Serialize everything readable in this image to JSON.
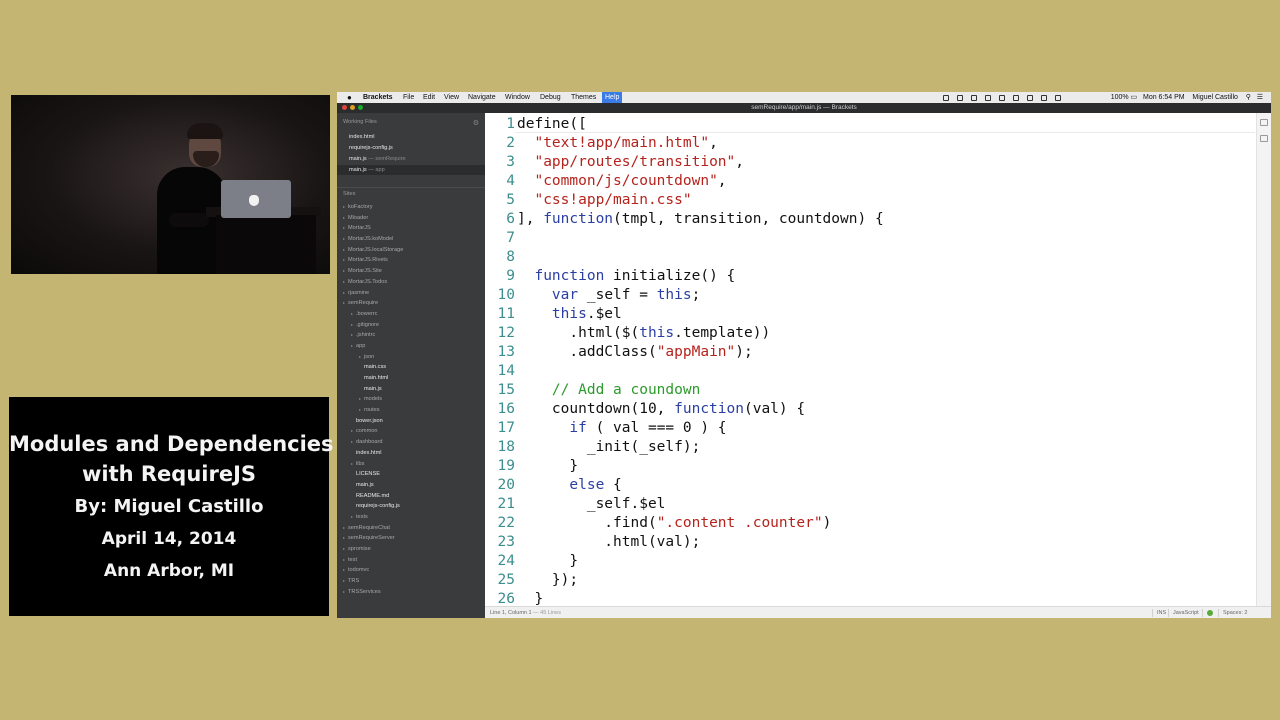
{
  "card": {
    "title_line1": "Modules and Dependencies",
    "title_line2": "with RequireJS",
    "byline": "By: Miguel Castillo",
    "date": "April 14, 2014",
    "location": "Ann Arbor, MI"
  },
  "menubar": {
    "app": "Brackets",
    "items": [
      "File",
      "Edit",
      "View",
      "Navigate",
      "Window",
      "Debug",
      "Themes",
      "Help"
    ],
    "selected": "Help",
    "battery": "100%",
    "clock": "Mon 6:54 PM",
    "user": "Miguel Castillo"
  },
  "window": {
    "title": "semRequire/app/main.js — Brackets"
  },
  "sidebar": {
    "working_files_label": "Working Files",
    "working_files": [
      {
        "name": "index.html",
        "detail": ""
      },
      {
        "name": "requirejs-config.js",
        "detail": ""
      },
      {
        "name": "main.js",
        "detail": "— semRequire"
      },
      {
        "name": "main.js",
        "detail": "— app"
      }
    ],
    "sites_label": "Sites",
    "tree": [
      {
        "label": "koFactory",
        "kind": "folder",
        "depth": 0
      },
      {
        "label": "Mloader",
        "kind": "folder",
        "depth": 0
      },
      {
        "label": "MortarJS",
        "kind": "folder",
        "depth": 0
      },
      {
        "label": "MortarJS.koModel",
        "kind": "folder",
        "depth": 0
      },
      {
        "label": "MortarJS.localStorage",
        "kind": "folder",
        "depth": 0
      },
      {
        "label": "MortarJS.Rivets",
        "kind": "folder",
        "depth": 0
      },
      {
        "label": "MortarJS.Site",
        "kind": "folder",
        "depth": 0
      },
      {
        "label": "MortarJS.Todos",
        "kind": "folder",
        "depth": 0
      },
      {
        "label": "rjasmine",
        "kind": "folder",
        "depth": 0
      },
      {
        "label": "semRequire",
        "kind": "folder",
        "depth": 0
      },
      {
        "label": ".bowerrc",
        "kind": "folder",
        "depth": 1
      },
      {
        "label": ".gitignore",
        "kind": "folder",
        "depth": 1
      },
      {
        "label": ".jshintrc",
        "kind": "folder",
        "depth": 1
      },
      {
        "label": "app",
        "kind": "folder",
        "depth": 1
      },
      {
        "label": "json",
        "kind": "folder",
        "depth": 2
      },
      {
        "label": "main.css",
        "kind": "file",
        "depth": 2
      },
      {
        "label": "main.html",
        "kind": "file",
        "depth": 2
      },
      {
        "label": "main.js",
        "kind": "file",
        "depth": 2
      },
      {
        "label": "models",
        "kind": "folder",
        "depth": 2
      },
      {
        "label": "routes",
        "kind": "folder",
        "depth": 2
      },
      {
        "label": "bower.json",
        "kind": "file",
        "depth": 1
      },
      {
        "label": "common",
        "kind": "folder",
        "depth": 1
      },
      {
        "label": "dashboard",
        "kind": "folder",
        "depth": 1
      },
      {
        "label": "index.html",
        "kind": "file",
        "depth": 1
      },
      {
        "label": "libs",
        "kind": "folder",
        "depth": 1
      },
      {
        "label": "LICENSE",
        "kind": "file",
        "depth": 1
      },
      {
        "label": "main.js",
        "kind": "file",
        "depth": 1
      },
      {
        "label": "README.md",
        "kind": "file",
        "depth": 1
      },
      {
        "label": "requirejs-config.js",
        "kind": "file",
        "depth": 1
      },
      {
        "label": "tests",
        "kind": "folder",
        "depth": 1
      },
      {
        "label": "semRequireChat",
        "kind": "folder",
        "depth": 0
      },
      {
        "label": "semRequireServer",
        "kind": "folder",
        "depth": 0
      },
      {
        "label": "spromise",
        "kind": "folder",
        "depth": 0
      },
      {
        "label": "test",
        "kind": "folder",
        "depth": 0
      },
      {
        "label": "todomvc",
        "kind": "folder",
        "depth": 0
      },
      {
        "label": "TRS",
        "kind": "folder",
        "depth": 0
      },
      {
        "label": "TRSServices",
        "kind": "folder",
        "depth": 0
      }
    ]
  },
  "editor": {
    "lines": [
      {
        "n": "1",
        "html": "define(["
      },
      {
        "n": "2",
        "html": "  <span class=\"s\">\"text!app/main.html\"</span>,"
      },
      {
        "n": "3",
        "html": "  <span class=\"s\">\"app/routes/transition\"</span>,"
      },
      {
        "n": "4",
        "html": "  <span class=\"s\">\"common/js/countdown\"</span>,"
      },
      {
        "n": "5",
        "html": "  <span class=\"s\">\"css!app/main.css\"</span>"
      },
      {
        "n": "6",
        "html": "], <span class=\"k\">function</span>(tmpl, transition, countdown) {"
      },
      {
        "n": "7",
        "html": ""
      },
      {
        "n": "8",
        "html": ""
      },
      {
        "n": "9",
        "html": "  <span class=\"k\">function</span> initialize() {"
      },
      {
        "n": "10",
        "html": "    <span class=\"k\">var</span> _self = <span class=\"k\">this</span>;"
      },
      {
        "n": "11",
        "html": "    <span class=\"k\">this</span>.$el"
      },
      {
        "n": "12",
        "html": "      .html($(<span class=\"k\">this</span>.template))"
      },
      {
        "n": "13",
        "html": "      .addClass(<span class=\"s\">\"appMain\"</span>);"
      },
      {
        "n": "14",
        "html": ""
      },
      {
        "n": "15",
        "html": "    <span class=\"c\">// Add a coundown</span>"
      },
      {
        "n": "16",
        "html": "    countdown(10, <span class=\"k\">function</span>(val) {"
      },
      {
        "n": "17",
        "html": "      <span class=\"k\">if</span> ( val === 0 ) {"
      },
      {
        "n": "18",
        "html": "        _init(_self);"
      },
      {
        "n": "19",
        "html": "      }"
      },
      {
        "n": "20",
        "html": "      <span class=\"k\">else</span> {"
      },
      {
        "n": "21",
        "html": "        _self.$el"
      },
      {
        "n": "22",
        "html": "          .find(<span class=\"s\">\".content .counter\"</span>)"
      },
      {
        "n": "23",
        "html": "          .html(val);"
      },
      {
        "n": "24",
        "html": "      }"
      },
      {
        "n": "25",
        "html": "    });"
      },
      {
        "n": "26",
        "html": "  }"
      }
    ]
  },
  "statusbar": {
    "position": "Line 1, Column 1",
    "line_count": "— 45 Lines",
    "mode": "INS",
    "language": "JavaScript",
    "spaces": "Spaces: 2"
  }
}
